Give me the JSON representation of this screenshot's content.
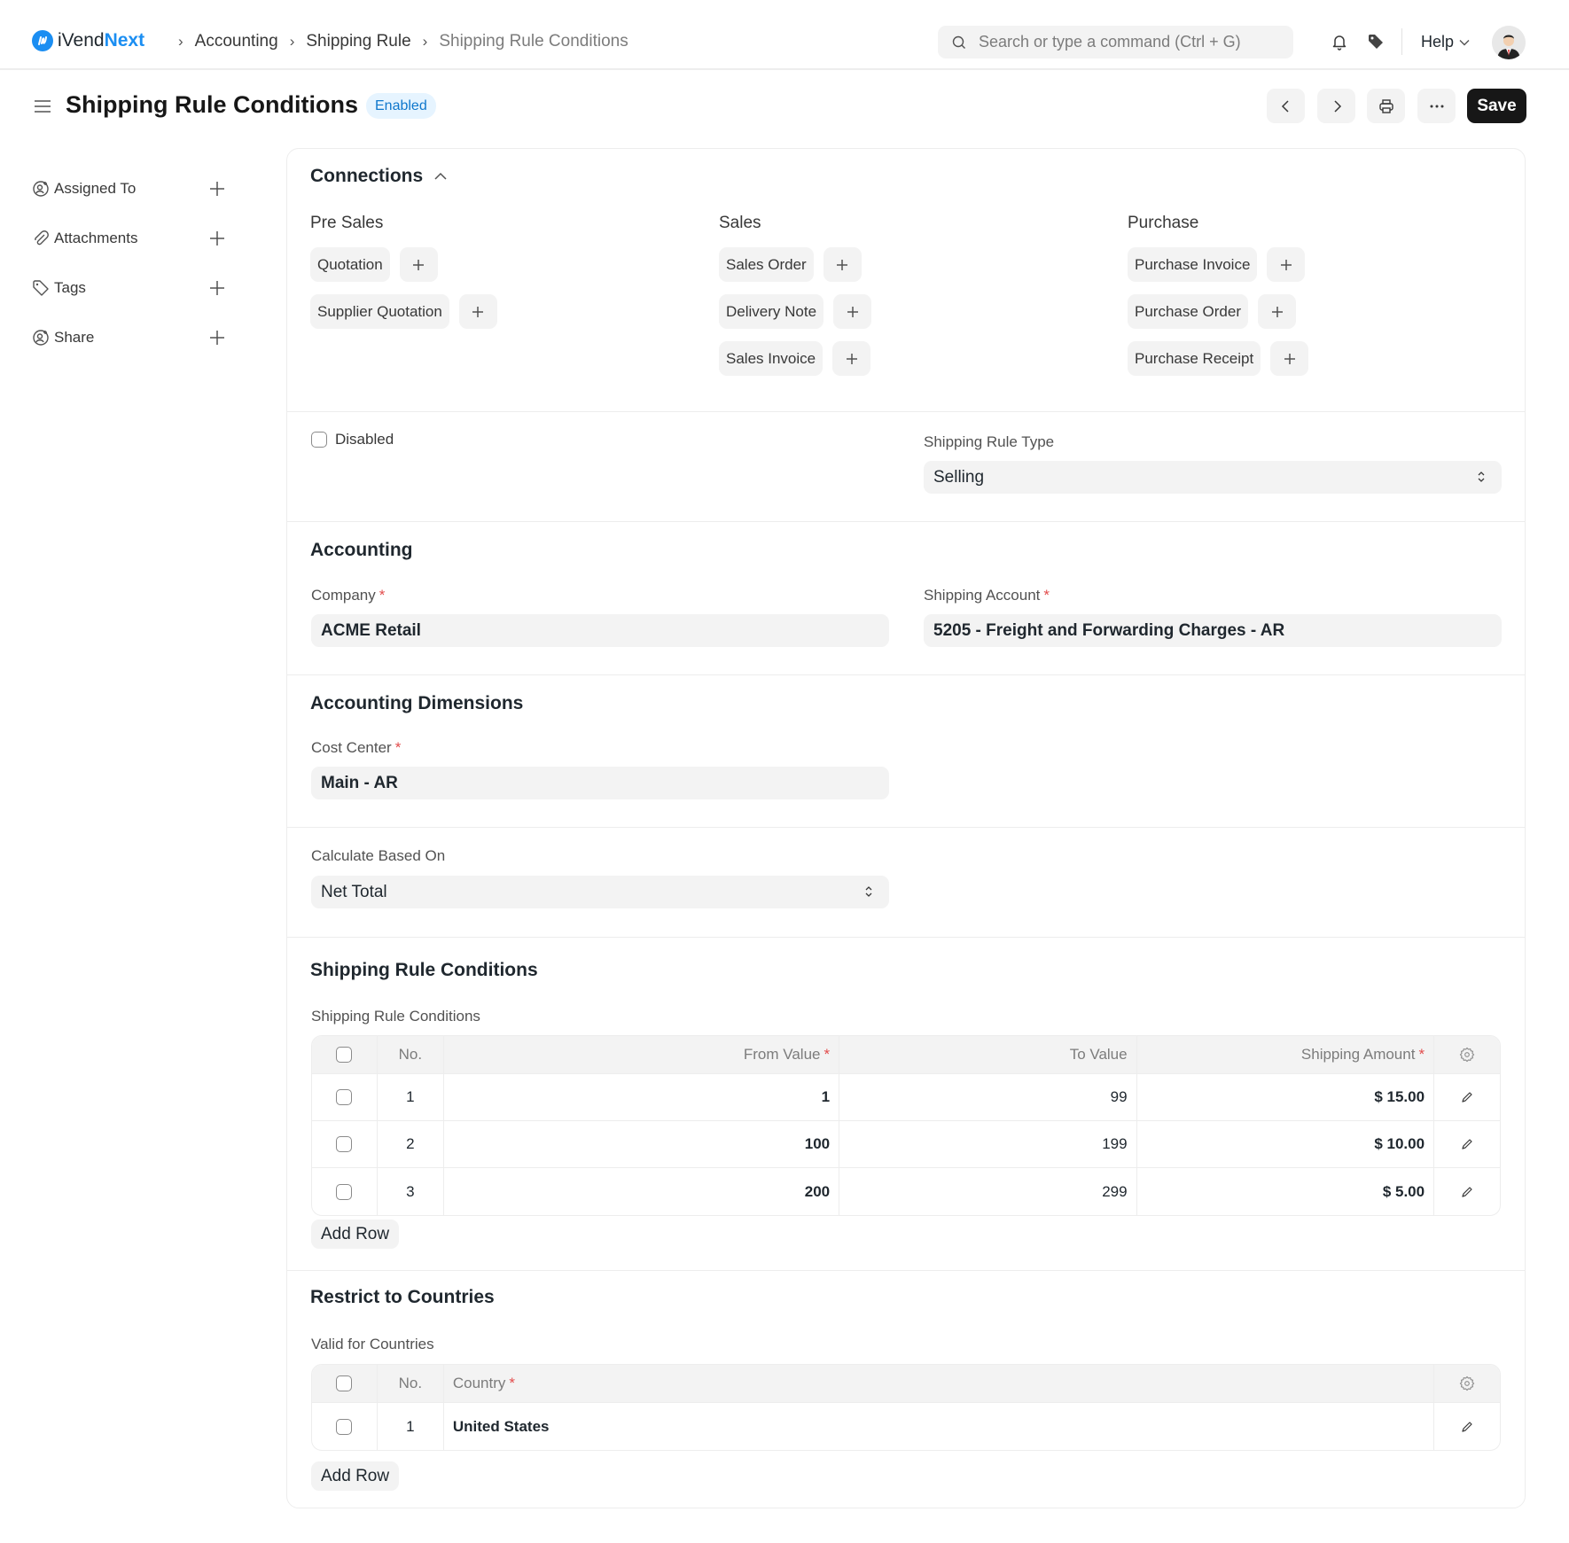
{
  "brand": {
    "name_plain": "iVend",
    "name_accent": "Next",
    "accent_color": "#1b8ef2"
  },
  "breadcrumbs": [
    {
      "label": "Accounting"
    },
    {
      "label": "Shipping Rule"
    },
    {
      "label": "Shipping Rule Conditions"
    }
  ],
  "navbar": {
    "search_placeholder": "Search or type a command (Ctrl + G)",
    "help_label": "Help",
    "icons": [
      "bell-icon",
      "tag-icon"
    ]
  },
  "page": {
    "title": "Shipping Rule Conditions",
    "status_badge": "Enabled",
    "save_label": "Save",
    "actions": [
      "previous-icon",
      "next-icon",
      "printer-icon",
      "more-icon"
    ]
  },
  "sidebar": {
    "items": [
      {
        "label": "Assigned To",
        "icon": "user-plus-icon"
      },
      {
        "label": "Attachments",
        "icon": "paperclip-icon"
      },
      {
        "label": "Tags",
        "icon": "tag-icon"
      },
      {
        "label": "Share",
        "icon": "user-share-icon"
      }
    ]
  },
  "connections": {
    "title": "Connections",
    "groups": [
      {
        "title": "Pre Sales",
        "items": [
          "Quotation",
          "Supplier Quotation"
        ]
      },
      {
        "title": "Sales",
        "items": [
          "Sales Order",
          "Delivery Note",
          "Sales Invoice"
        ]
      },
      {
        "title": "Purchase",
        "items": [
          "Purchase Invoice",
          "Purchase Order",
          "Purchase Receipt"
        ]
      }
    ]
  },
  "settings": {
    "disabled_label": "Disabled",
    "disabled_checked": false,
    "shipping_rule_type_label": "Shipping Rule Type",
    "shipping_rule_type_value": "Selling"
  },
  "accounting": {
    "title": "Accounting",
    "company_label": "Company",
    "company_value": "ACME Retail",
    "shipping_account_label": "Shipping Account",
    "shipping_account_value": "5205 - Freight and Forwarding Charges - AR"
  },
  "dimensions": {
    "title": "Accounting Dimensions",
    "cost_center_label": "Cost Center",
    "cost_center_value": "Main - AR"
  },
  "calculation": {
    "label": "Calculate Based On",
    "value": "Net Total"
  },
  "conditions": {
    "title": "Shipping Rule Conditions",
    "table_label": "Shipping Rule Conditions",
    "columns": {
      "no": "No.",
      "from": "From Value",
      "to": "To Value",
      "amount": "Shipping Amount"
    },
    "rows": [
      {
        "no": "1",
        "from": "1",
        "to": "99",
        "amount": "$ 15.00"
      },
      {
        "no": "2",
        "from": "100",
        "to": "199",
        "amount": "$ 10.00"
      },
      {
        "no": "3",
        "from": "200",
        "to": "299",
        "amount": "$ 5.00"
      }
    ],
    "add_row_label": "Add Row"
  },
  "countries": {
    "title": "Restrict to Countries",
    "table_label": "Valid for Countries",
    "columns": {
      "no": "No.",
      "country": "Country"
    },
    "rows": [
      {
        "no": "1",
        "country": "United States"
      }
    ],
    "add_row_label": "Add Row"
  }
}
